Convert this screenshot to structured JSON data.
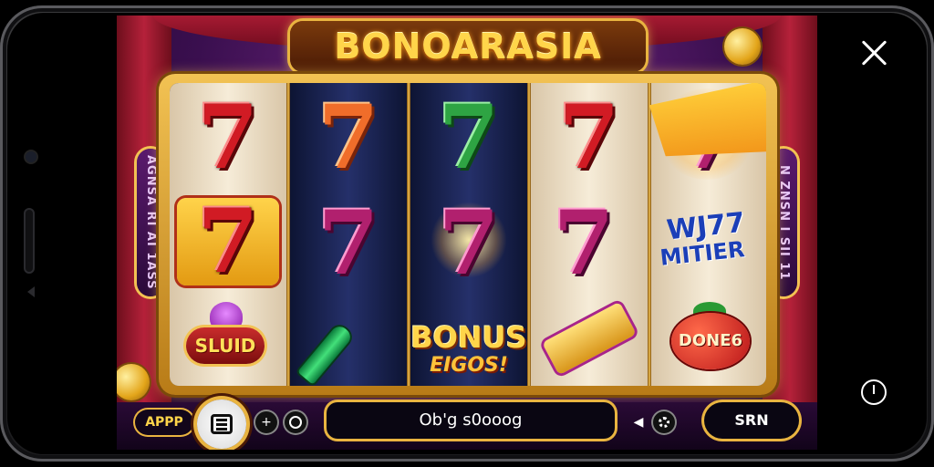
{
  "game": {
    "title": "BONOARASIA",
    "side_left_text": "AGNSA RI AI 1ASS",
    "side_right_text": "N ZNSN I SII 11",
    "reels": [
      {
        "symbols": [
          "7",
          "7"
        ],
        "badge": "SLUID"
      },
      {
        "symbols": [
          "7",
          "7"
        ]
      },
      {
        "symbols": [
          "7",
          "7"
        ],
        "bonus_title": "BONUS",
        "bonus_sub": "EIGOS!"
      },
      {
        "symbols": [
          "7",
          "7"
        ]
      },
      {
        "symbols": [
          "7"
        ],
        "multiplier_top": "WJ77",
        "multiplier_bottom": "MITIER",
        "badge": "DONE6"
      }
    ]
  },
  "hud": {
    "app_label": "APPP",
    "plus_label": "+",
    "balance_text": "Ob'g s0ooog",
    "sound_label": "◀",
    "spin_label": "SRN"
  },
  "colors": {
    "accent_gold": "#e9b440",
    "background_purple": "#3a0f4f",
    "red_seven": "#d11b24"
  },
  "icons": [
    "close-icon",
    "power-icon",
    "menu-icon",
    "coin-icon"
  ]
}
